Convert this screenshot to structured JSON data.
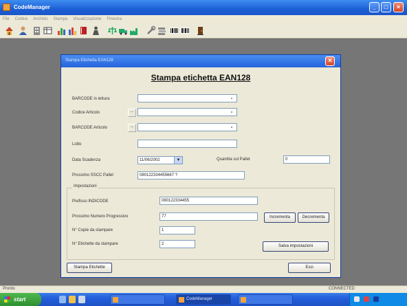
{
  "app": {
    "title": "CodeManager",
    "window_controls": {
      "minimize": "_",
      "maximize": "□",
      "close": "×"
    }
  },
  "menubar": [
    "File",
    "Codice",
    "Archivio",
    "Stampa",
    "Visualizzazione",
    "Finestra"
  ],
  "toolbar": {
    "icons": [
      "house-icon",
      "user-icon",
      "building-icon",
      "table-icon",
      "chart-icon",
      "chart-icon",
      "book-icon",
      "person-icon",
      "scale-icon",
      "truck-icon",
      "factory-icon",
      "wrench-icon",
      "layers-icon",
      "barcode-icon",
      "barcode-icon",
      "exit-icon"
    ]
  },
  "dialog": {
    "title": "Stampa Etichetta EAN128",
    "close_symbol": "×",
    "heading": "Stampa etichetta EAN128",
    "fields": {
      "barcode_lettura": {
        "label": "BARCODE in lettura",
        "value": ""
      },
      "codice_articolo": {
        "label": "Codice Articolo",
        "value": "",
        "button": "..."
      },
      "barcode_articolo": {
        "label": "BARCODE Articolo",
        "value": "",
        "button": "..."
      },
      "lotto": {
        "label": "Lotto",
        "value": ""
      },
      "data_scadenza": {
        "label": "Data Scadenza",
        "value": "11/06/2002",
        "arrow": "▼"
      },
      "quantita_pallet": {
        "label": "Quantita sul Pallet",
        "value": "0"
      },
      "prossimo_sscc": {
        "label": "Prossimo SSCC Pallet",
        "value": "080122334455667 ?"
      }
    },
    "group": {
      "title": "Impostazioni",
      "prefisso": {
        "label": "Prefisso INDICODE",
        "value": "080122334455"
      },
      "prossimo_numero": {
        "label": "Prossimo Numero Progressivo",
        "value": "77"
      },
      "copie": {
        "label": "N° Copie da stampare",
        "value": "1"
      },
      "etichette": {
        "label": "N° Etichette da stampare",
        "value": "2"
      },
      "incrementa_button": "Incrementa",
      "decrementa_button": "Decrementa",
      "salva_button": "Salva impostazioni"
    },
    "stampa_button": "Stampa Etichette",
    "esci_button": "Esci"
  },
  "statusbar": {
    "left": "Pronto",
    "right": "CONNECTED"
  },
  "taskbar": {
    "start_label": "start",
    "tasks": [
      "",
      "",
      "CodeManager",
      ""
    ],
    "clock": ""
  }
}
